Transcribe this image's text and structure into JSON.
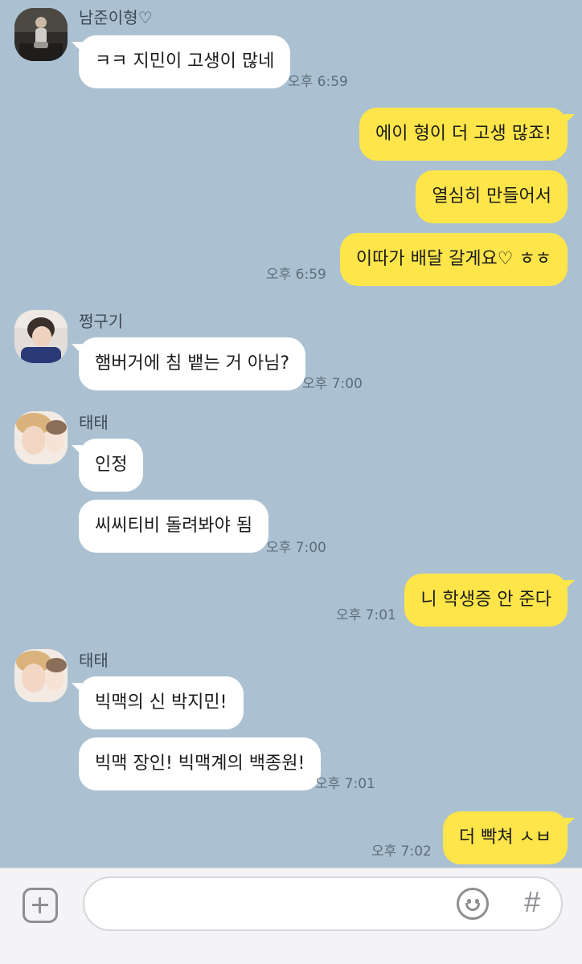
{
  "messages": {
    "m1": {
      "sender": "남준이형♡",
      "text": "ㅋㅋ 지민이 고생이 많네",
      "time": "오후 6:59"
    },
    "m2": {
      "text": "에이 형이 더 고생 많죠!"
    },
    "m3": {
      "text": "열심히 만들어서"
    },
    "m4": {
      "text": "이따가 배달 갈게요♡ ㅎㅎ",
      "time": "오후 6:59"
    },
    "m5": {
      "sender": "쩡구기",
      "text": "햄버거에 침 뱉는 거 아님?",
      "time": "오후 7:00"
    },
    "m6": {
      "sender": "태태",
      "text": "인정"
    },
    "m7": {
      "text": "씨씨티비 돌려봐야 됨",
      "time": "오후 7:00"
    },
    "m8": {
      "text": "니 학생증 안 준다",
      "time": "오후 7:01"
    },
    "m9": {
      "sender": "태태",
      "text": "빅맥의 신 박지민!"
    },
    "m10": {
      "text": "빅맥 장인! 빅맥계의 백종원!",
      "time": "오후 7:01"
    },
    "m11": {
      "text": "더 빡쳐 ㅅㅂ",
      "time": "오후 7:02"
    }
  },
  "input": {
    "placeholder": ""
  },
  "icons": {
    "add": "plus-square-icon",
    "emoji": "smiley-icon",
    "hashtag": "hash-icon"
  },
  "colors": {
    "background": "#abc1d1",
    "incoming_bubble": "#ffffff",
    "outgoing_bubble": "#fde54a"
  }
}
